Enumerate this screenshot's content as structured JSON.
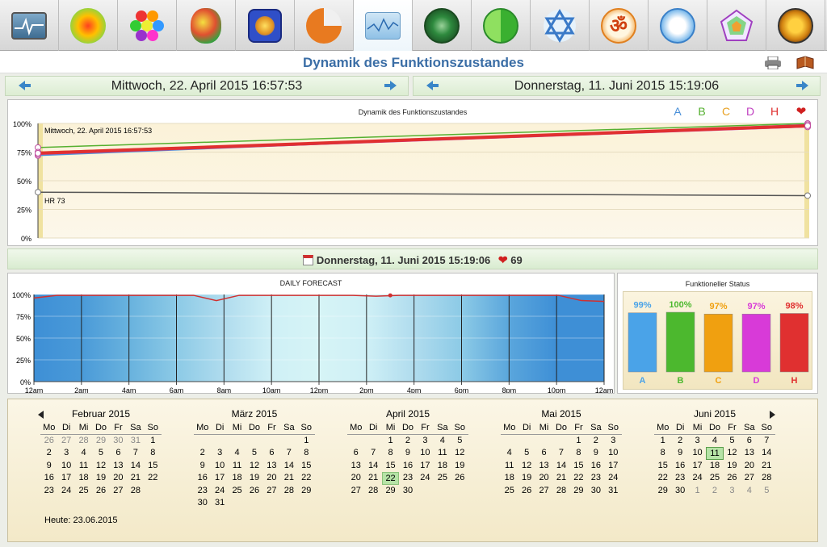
{
  "toolbar": {
    "icons": [
      "monitor-chart-icon",
      "sun-orb-icon",
      "hexagon-grid-icon",
      "brain-map-icon",
      "mandala-square-icon",
      "pie-chart-icon",
      "pulse-wave-icon",
      "spiral-icon",
      "yin-yang-icon",
      "star-of-david-icon",
      "om-icon",
      "head-profile-icon",
      "radar-pentagon-icon",
      "hq-logo-icon"
    ],
    "active_index": 6
  },
  "page": {
    "title": "Dynamik des Funktionszustandes"
  },
  "nav": {
    "left_date": "Mittwoch, 22. April 2015 16:57:53",
    "right_date": "Donnerstag, 11. Juni 2015 15:19:06"
  },
  "top_chart": {
    "title": "Dynamik des Funktionszustandes",
    "start_label": "Mittwoch, 22. April 2015 16:57:53",
    "hr_label": "HR 73",
    "legend": [
      "A",
      "B",
      "C",
      "D",
      "H"
    ],
    "legend_colors": [
      "#4a90d9",
      "#55b030",
      "#e8a020",
      "#c040c0",
      "#e03030"
    ],
    "yticks": [
      "100%",
      "75%",
      "50%",
      "25%",
      "0%"
    ]
  },
  "chart_data": [
    {
      "type": "line",
      "title": "Dynamik des Funktionszustandes",
      "yticks": [
        "100%",
        "75%",
        "50%",
        "25%",
        "0%"
      ],
      "ylim": [
        0,
        100
      ],
      "series": [
        {
          "name": "A",
          "values": [
            72,
            99
          ]
        },
        {
          "name": "B",
          "values": [
            79,
            100
          ]
        },
        {
          "name": "C",
          "values": [
            75,
            97
          ]
        },
        {
          "name": "D",
          "values": [
            73,
            97
          ]
        },
        {
          "name": "H",
          "values": [
            74,
            98
          ]
        },
        {
          "name": "HR",
          "values": [
            40,
            37
          ]
        }
      ]
    },
    {
      "type": "area",
      "title": "DAILY FORECAST",
      "categories": [
        "12am",
        "2am",
        "4am",
        "6am",
        "8am",
        "10am",
        "12pm",
        "2pm",
        "4pm",
        "6pm",
        "8pm",
        "10pm",
        "12am"
      ],
      "yticks": [
        "100%",
        "75%",
        "50%",
        "25%",
        "0%"
      ],
      "ylim": [
        0,
        100
      ],
      "line": [
        96,
        99,
        99,
        99,
        99,
        99,
        99,
        99,
        93,
        99,
        99,
        99,
        99,
        99,
        99,
        98,
        99,
        99,
        99,
        99,
        99,
        99,
        99,
        99,
        93,
        92
      ]
    },
    {
      "type": "bar",
      "title": "Funktioneller Status",
      "categories": [
        "A",
        "B",
        "C",
        "D",
        "H"
      ],
      "values": [
        99,
        100,
        97,
        97,
        98
      ],
      "value_labels": [
        "99%",
        "100%",
        "97%",
        "97%",
        "98%"
      ],
      "colors": [
        "#4aa3e8",
        "#4cb82e",
        "#f0a010",
        "#d83ad8",
        "#e03030"
      ],
      "ylim": [
        0,
        100
      ]
    }
  ],
  "status": {
    "date": "Donnerstag, 11. Juni 2015 15:19:06",
    "hr": "69"
  },
  "calendar": {
    "weekdays": [
      "Mo",
      "Di",
      "Mi",
      "Do",
      "Fr",
      "Sa",
      "So"
    ],
    "today_label": "Heute: 23.06.2015",
    "months": [
      {
        "name": "Februar 2015",
        "days": [
          "26",
          "27",
          "28",
          "29",
          "30",
          "31",
          "1",
          "2",
          "3",
          "4",
          "5",
          "6",
          "7",
          "8",
          "9",
          "10",
          "11",
          "12",
          "13",
          "14",
          "15",
          "16",
          "17",
          "18",
          "19",
          "20",
          "21",
          "22",
          "23",
          "24",
          "25",
          "26",
          "27",
          "28"
        ],
        "lead": 6
      },
      {
        "name": "März 2015",
        "days": [
          "",
          "",
          "",
          "",
          "",
          "",
          "1",
          "2",
          "3",
          "4",
          "5",
          "6",
          "7",
          "8",
          "9",
          "10",
          "11",
          "12",
          "13",
          "14",
          "15",
          "16",
          "17",
          "18",
          "19",
          "20",
          "21",
          "22",
          "23",
          "24",
          "25",
          "26",
          "27",
          "28",
          "29",
          "30",
          "31"
        ]
      },
      {
        "name": "April 2015",
        "days": [
          "",
          "",
          "1",
          "2",
          "3",
          "4",
          "5",
          "6",
          "7",
          "8",
          "9",
          "10",
          "11",
          "12",
          "13",
          "14",
          "15",
          "16",
          "17",
          "18",
          "19",
          "20",
          "21",
          "22",
          "23",
          "24",
          "25",
          "26",
          "27",
          "28",
          "29",
          "30"
        ],
        "selected": "22"
      },
      {
        "name": "Mai 2015",
        "days": [
          "",
          "",
          "",
          "",
          "1",
          "2",
          "3",
          "4",
          "5",
          "6",
          "7",
          "8",
          "9",
          "10",
          "11",
          "12",
          "13",
          "14",
          "15",
          "16",
          "17",
          "18",
          "19",
          "20",
          "21",
          "22",
          "23",
          "24",
          "25",
          "26",
          "27",
          "28",
          "29",
          "30",
          "31"
        ]
      },
      {
        "name": "Juni 2015",
        "days": [
          "1",
          "2",
          "3",
          "4",
          "5",
          "6",
          "7",
          "8",
          "9",
          "10",
          "11",
          "12",
          "13",
          "14",
          "15",
          "16",
          "17",
          "18",
          "19",
          "20",
          "21",
          "22",
          "23",
          "24",
          "25",
          "26",
          "27",
          "28",
          "29",
          "30",
          "1",
          "2",
          "3",
          "4",
          "5"
        ],
        "trail": 5,
        "selected": "11"
      }
    ]
  }
}
